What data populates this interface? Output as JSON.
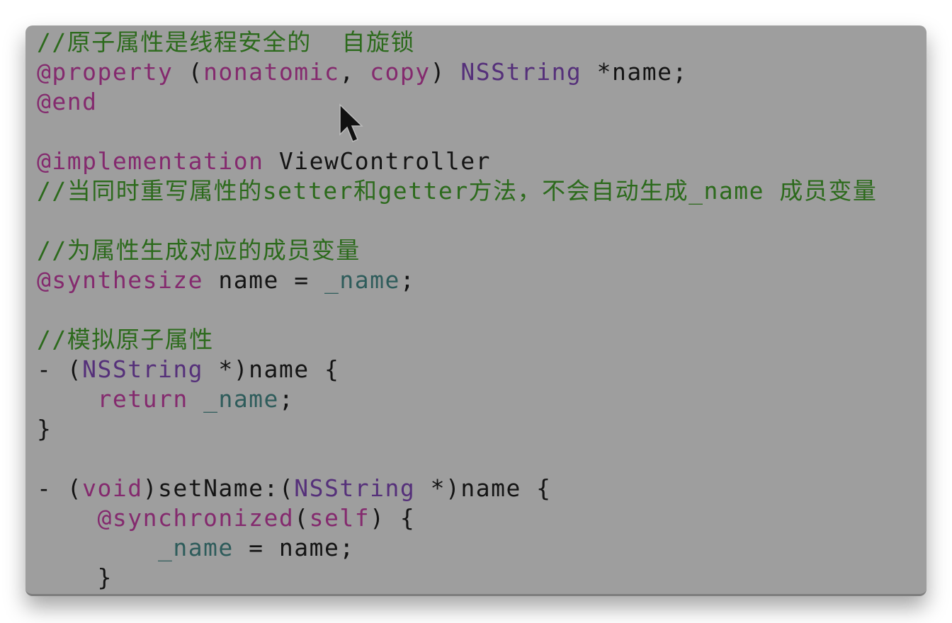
{
  "editor": {
    "colors": {
      "keyword": "#842a6e",
      "type": "#55307a",
      "comment": "#2c6a1c",
      "ivar": "#2e5c5b",
      "plain": "#141414",
      "background": "#9e9e9e"
    },
    "lines": [
      [
        [
          "//原子属性是线程安全的  自旋锁",
          "cm"
        ]
      ],
      [
        [
          "@property",
          "kw"
        ],
        [
          " (",
          "plain"
        ],
        [
          "nonatomic",
          "kw"
        ],
        [
          ", ",
          "plain"
        ],
        [
          "copy",
          "kw"
        ],
        [
          ") ",
          "plain"
        ],
        [
          "NSString",
          "type"
        ],
        [
          " *name;",
          "plain"
        ]
      ],
      [
        [
          "@end",
          "kw"
        ]
      ],
      [],
      [
        [
          "@implementation",
          "kw"
        ],
        [
          " ViewController",
          "plain"
        ]
      ],
      [
        [
          "//当同时重写属性的setter和getter方法，不会自动生成_name 成员变量",
          "cm"
        ]
      ],
      [],
      [
        [
          "//为属性生成对应的成员变量",
          "cm"
        ]
      ],
      [
        [
          "@synthesize",
          "kw"
        ],
        [
          " name = ",
          "plain"
        ],
        [
          "_name",
          "ivar"
        ],
        [
          ";",
          "plain"
        ]
      ],
      [],
      [
        [
          "//模拟原子属性",
          "cm"
        ]
      ],
      [
        [
          "- (",
          "plain"
        ],
        [
          "NSString",
          "type"
        ],
        [
          " *)name {",
          "plain"
        ]
      ],
      [
        [
          "    ",
          "plain"
        ],
        [
          "return",
          "kw"
        ],
        [
          " ",
          "plain"
        ],
        [
          "_name",
          "ivar"
        ],
        [
          ";",
          "plain"
        ]
      ],
      [
        [
          "}",
          "plain"
        ]
      ],
      [],
      [
        [
          "- (",
          "plain"
        ],
        [
          "void",
          "kw"
        ],
        [
          ")setName:(",
          "plain"
        ],
        [
          "NSString",
          "type"
        ],
        [
          " *)name {",
          "plain"
        ]
      ],
      [
        [
          "    ",
          "plain"
        ],
        [
          "@synchronized",
          "kw"
        ],
        [
          "(",
          "plain"
        ],
        [
          "self",
          "kw"
        ],
        [
          ") {",
          "plain"
        ]
      ],
      [
        [
          "        ",
          "plain"
        ],
        [
          "_name",
          "ivar"
        ],
        [
          " = name;",
          "plain"
        ]
      ],
      [
        [
          "    }",
          "plain"
        ]
      ]
    ],
    "cursor_icon": "arrow-pointer"
  }
}
